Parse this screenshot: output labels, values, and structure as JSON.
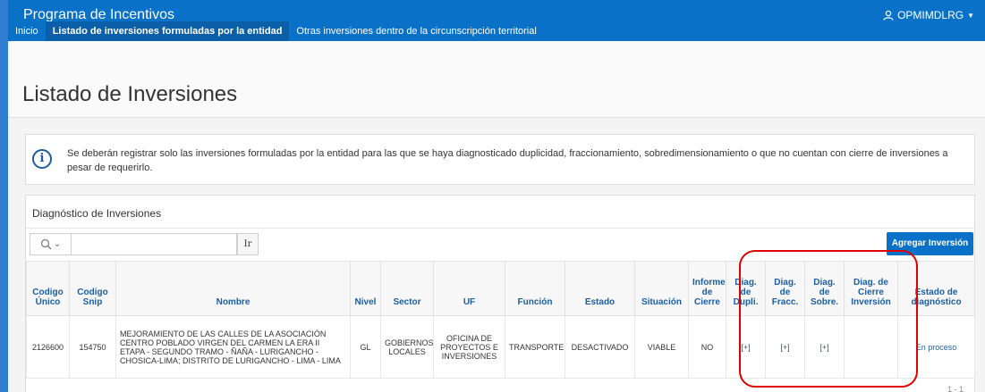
{
  "app": {
    "title": "Programa de Incentivos",
    "user": "OPMIMDLRG"
  },
  "nav": [
    {
      "label": "Inicio",
      "active": false
    },
    {
      "label": "Listado de inversiones formuladas por la entidad",
      "active": true
    },
    {
      "label": "Otras inversiones dentro de la circunscripción territorial",
      "active": false
    }
  ],
  "page": {
    "title": "Listado de Inversiones"
  },
  "info": {
    "text": "Se deberán registrar solo las inversiones formuladas por la entidad para las que se haya diagnosticado duplicidad, fraccionamiento, sobredimensionamiento o que no cuentan con cierre de inversiones a pesar de requerirlo."
  },
  "region": {
    "title": "Diagnóstico de Inversiones",
    "search_value": "",
    "go_label": "Ir",
    "add_label": "Agregar Inversión",
    "pagination": "1 - 1"
  },
  "table": {
    "columns": [
      "Codigo Único",
      "Codigo Snip",
      "Nombre",
      "Nivel",
      "Sector",
      "UF",
      "Función",
      "Estado",
      "Situación",
      "Informe de Cierre",
      "Diag. de Dupli.",
      "Diag. de Fracc.",
      "Diag. de Sobre.",
      "Diag. de Cierre Inversión",
      "Estado de diagnóstico"
    ],
    "rows": [
      {
        "codigo_unico": "2126600",
        "codigo_snip": "154750",
        "nombre": "MEJORAMIENTO DE LAS CALLES DE LA ASOCIACIÓN CENTRO POBLADO VIRGEN DEL CARMEN LA ERA II ETAPA - SEGUNDO TRAMO - ÑAÑA - LURIGANCHO - CHOSICA-LIMA; DISTRITO DE LURIGANCHO - LIMA - LIMA",
        "nivel": "GL",
        "sector": "GOBIERNOS LOCALES",
        "uf": "OFICINA DE PROYECTOS E INVERSIONES",
        "funcion": "TRANSPORTE",
        "estado": "DESACTIVADO",
        "situacion": "VIABLE",
        "informe_cierre": "NO",
        "diag_dupli": "[+]",
        "diag_fracc": "[+]",
        "diag_sobre": "[+]",
        "diag_cierre": "",
        "estado_diagnostico": "En proceso"
      }
    ]
  },
  "colors": {
    "topbar": "#0a71c9",
    "nav_active": "#0b5fa8",
    "link": "#1a5ea6",
    "highlight": "#e00000"
  }
}
